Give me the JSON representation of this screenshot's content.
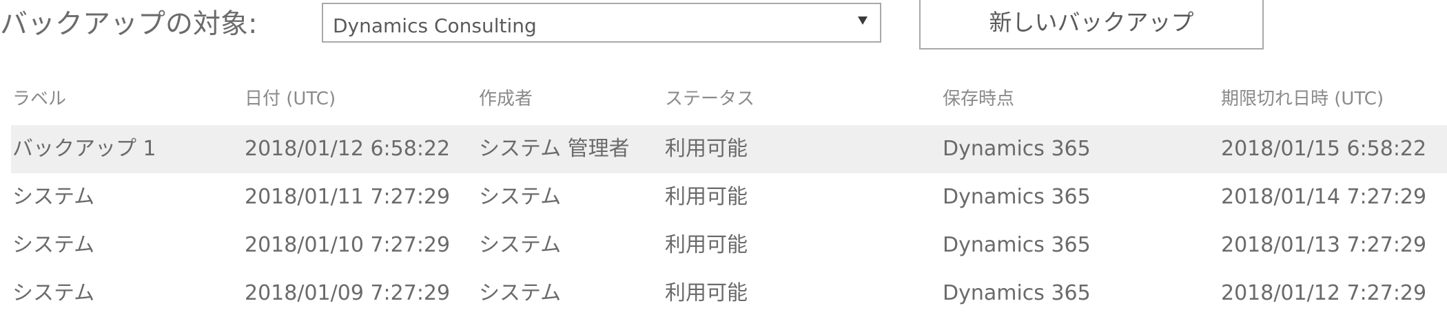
{
  "toolbar": {
    "target_label": "バックアップの対象:",
    "target_value": "Dynamics Consulting",
    "new_backup_label": "新しいバックアップ"
  },
  "table": {
    "columns": [
      "ラベル",
      "日付 (UTC)",
      "作成者",
      "ステータス",
      "保存時点",
      "期限切れ日時 (UTC)"
    ],
    "rows": [
      {
        "label": "バックアップ 1",
        "date": "2018/01/12 6:58:22",
        "created_by": "システム 管理者",
        "status": "利用可能",
        "version": "Dynamics 365",
        "expires": "2018/01/15 6:58:22",
        "selected": true
      },
      {
        "label": "システム",
        "date": "2018/01/11 7:27:29",
        "created_by": "システム",
        "status": "利用可能",
        "version": "Dynamics 365",
        "expires": "2018/01/14 7:27:29",
        "selected": false
      },
      {
        "label": "システム",
        "date": "2018/01/10 7:27:29",
        "created_by": "システム",
        "status": "利用可能",
        "version": "Dynamics 365",
        "expires": "2018/01/13 7:27:29",
        "selected": false
      },
      {
        "label": "システム",
        "date": "2018/01/09 7:27:29",
        "created_by": "システム",
        "status": "利用可能",
        "version": "Dynamics 365",
        "expires": "2018/01/12 7:27:29",
        "selected": false
      }
    ]
  }
}
